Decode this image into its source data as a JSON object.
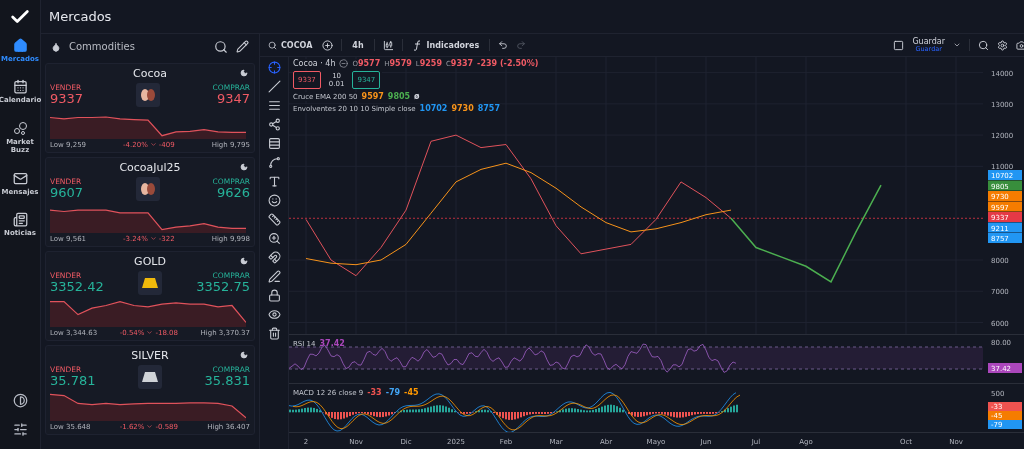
{
  "app": {
    "title": "Mercados"
  },
  "nav": [
    {
      "label": "Mercados",
      "kind": "home",
      "selected": true
    },
    {
      "label": "Calendario",
      "kind": "calendar",
      "selected": false
    },
    {
      "label": "Market Buzz",
      "kind": "buzz",
      "selected": false
    },
    {
      "label": "Mensajes",
      "kind": "mail",
      "selected": false
    },
    {
      "label": "Noticias",
      "kind": "news",
      "selected": false
    }
  ],
  "watchlist": {
    "title": "Commodities",
    "cards": [
      {
        "name": "Cocoa",
        "kind": "cocoa",
        "sell_label": "VENDER",
        "sell": "9337",
        "buy_label": "COMPRAR",
        "buy": "9347",
        "down": true,
        "low": "Low 9,259",
        "change_pct": "-4.20%",
        "change_abs": "-409",
        "high": "High 9,795"
      },
      {
        "name": "CocoaJul25",
        "kind": "cocoa",
        "sell_label": "VENDER",
        "sell": "9607",
        "buy_label": "COMPRAR",
        "buy": "9626",
        "down": false,
        "low": "Low 9,561",
        "change_pct": "-3.24%",
        "change_abs": "-322",
        "high": "High 9,998"
      },
      {
        "name": "GOLD",
        "kind": "gold",
        "sell_label": "VENDER",
        "sell": "3352.42",
        "buy_label": "COMPRAR",
        "buy": "3352.75",
        "down": false,
        "low": "Low 3,344.63",
        "change_pct": "-0.54%",
        "change_abs": "-18.08",
        "high": "High 3,370.37"
      },
      {
        "name": "SILVER",
        "kind": "silver",
        "sell_label": "VENDER",
        "sell": "35.781",
        "buy_label": "COMPRAR",
        "buy": "35.831",
        "down": false,
        "low": "Low 35.648",
        "change_pct": "-1.62%",
        "change_abs": "-0.589",
        "high": "High 36.407"
      }
    ]
  },
  "toolbar": {
    "symbol": "COCOA",
    "interval": "4h",
    "indicators": "Indicadores",
    "save": "Guardar",
    "save_sub": "Guardar"
  },
  "legend": {
    "ohlc": [
      {
        "label": "O",
        "value": "9577"
      },
      {
        "label": "H",
        "value": "9579"
      },
      {
        "label": "L",
        "value": "9259"
      },
      {
        "label": "C",
        "value": "9337"
      }
    ],
    "change": "-239 (-2.50%)",
    "sell": "9337",
    "qty": "10",
    "step": "0.01",
    "buy": "9347",
    "studies": [
      {
        "name": "Cruce EMA 200 50",
        "values": [
          {
            "text": "9597",
            "color": "#f7931a"
          },
          {
            "text": "9805",
            "color": "#4caf50"
          },
          {
            "text": "ø",
            "color": "#d1d4dc"
          }
        ]
      },
      {
        "name": "Envolventes 20 10 10 Simple close",
        "values": [
          {
            "text": "10702",
            "color": "#2196f3"
          },
          {
            "text": "9730",
            "color": "#f7931a"
          },
          {
            "text": "8757",
            "color": "#2196f3"
          }
        ]
      }
    ]
  },
  "price_tags": [
    {
      "text": "10702",
      "color": "#2196f3"
    },
    {
      "text": "9805",
      "color": "#388e3c"
    },
    {
      "text": "9730",
      "color": "#f57c00"
    },
    {
      "text": "9597",
      "color": "#f57c00"
    },
    {
      "text": "9337",
      "color": "#e53946"
    },
    {
      "text": "9211",
      "color": "#2196f3"
    },
    {
      "text": "8757",
      "color": "#2196f3"
    }
  ],
  "rsi": {
    "name": "RSI",
    "params": "14",
    "value": "37.42",
    "tick": "80.00",
    "tag": {
      "text": "37.42",
      "color": "#ab47bc"
    }
  },
  "macd": {
    "name": "MACD",
    "params": "12 26 close 9",
    "values": [
      {
        "text": "-33",
        "color": "#ef5350"
      },
      {
        "text": "-79",
        "color": "#42a5f5"
      },
      {
        "text": "-45",
        "color": "#ff9800"
      }
    ],
    "tick": "500",
    "tags": [
      {
        "text": "-33",
        "color": "#ef5350"
      },
      {
        "text": "-45",
        "color": "#f57c00"
      },
      {
        "text": "-79",
        "color": "#2196f3"
      }
    ]
  },
  "price_chart": {
    "title": "Cocoa · 4h",
    "y_labels": [
      "14000",
      "13000",
      "12000",
      "11000",
      "8000",
      "7000",
      "6000"
    ],
    "x_labels": [
      "2",
      "Nov",
      "Dic",
      "2025",
      "Feb",
      "Mar",
      "Abr",
      "Mayo",
      "Jun",
      "Jul",
      "Ago",
      "Oct",
      "Nov"
    ]
  }
}
